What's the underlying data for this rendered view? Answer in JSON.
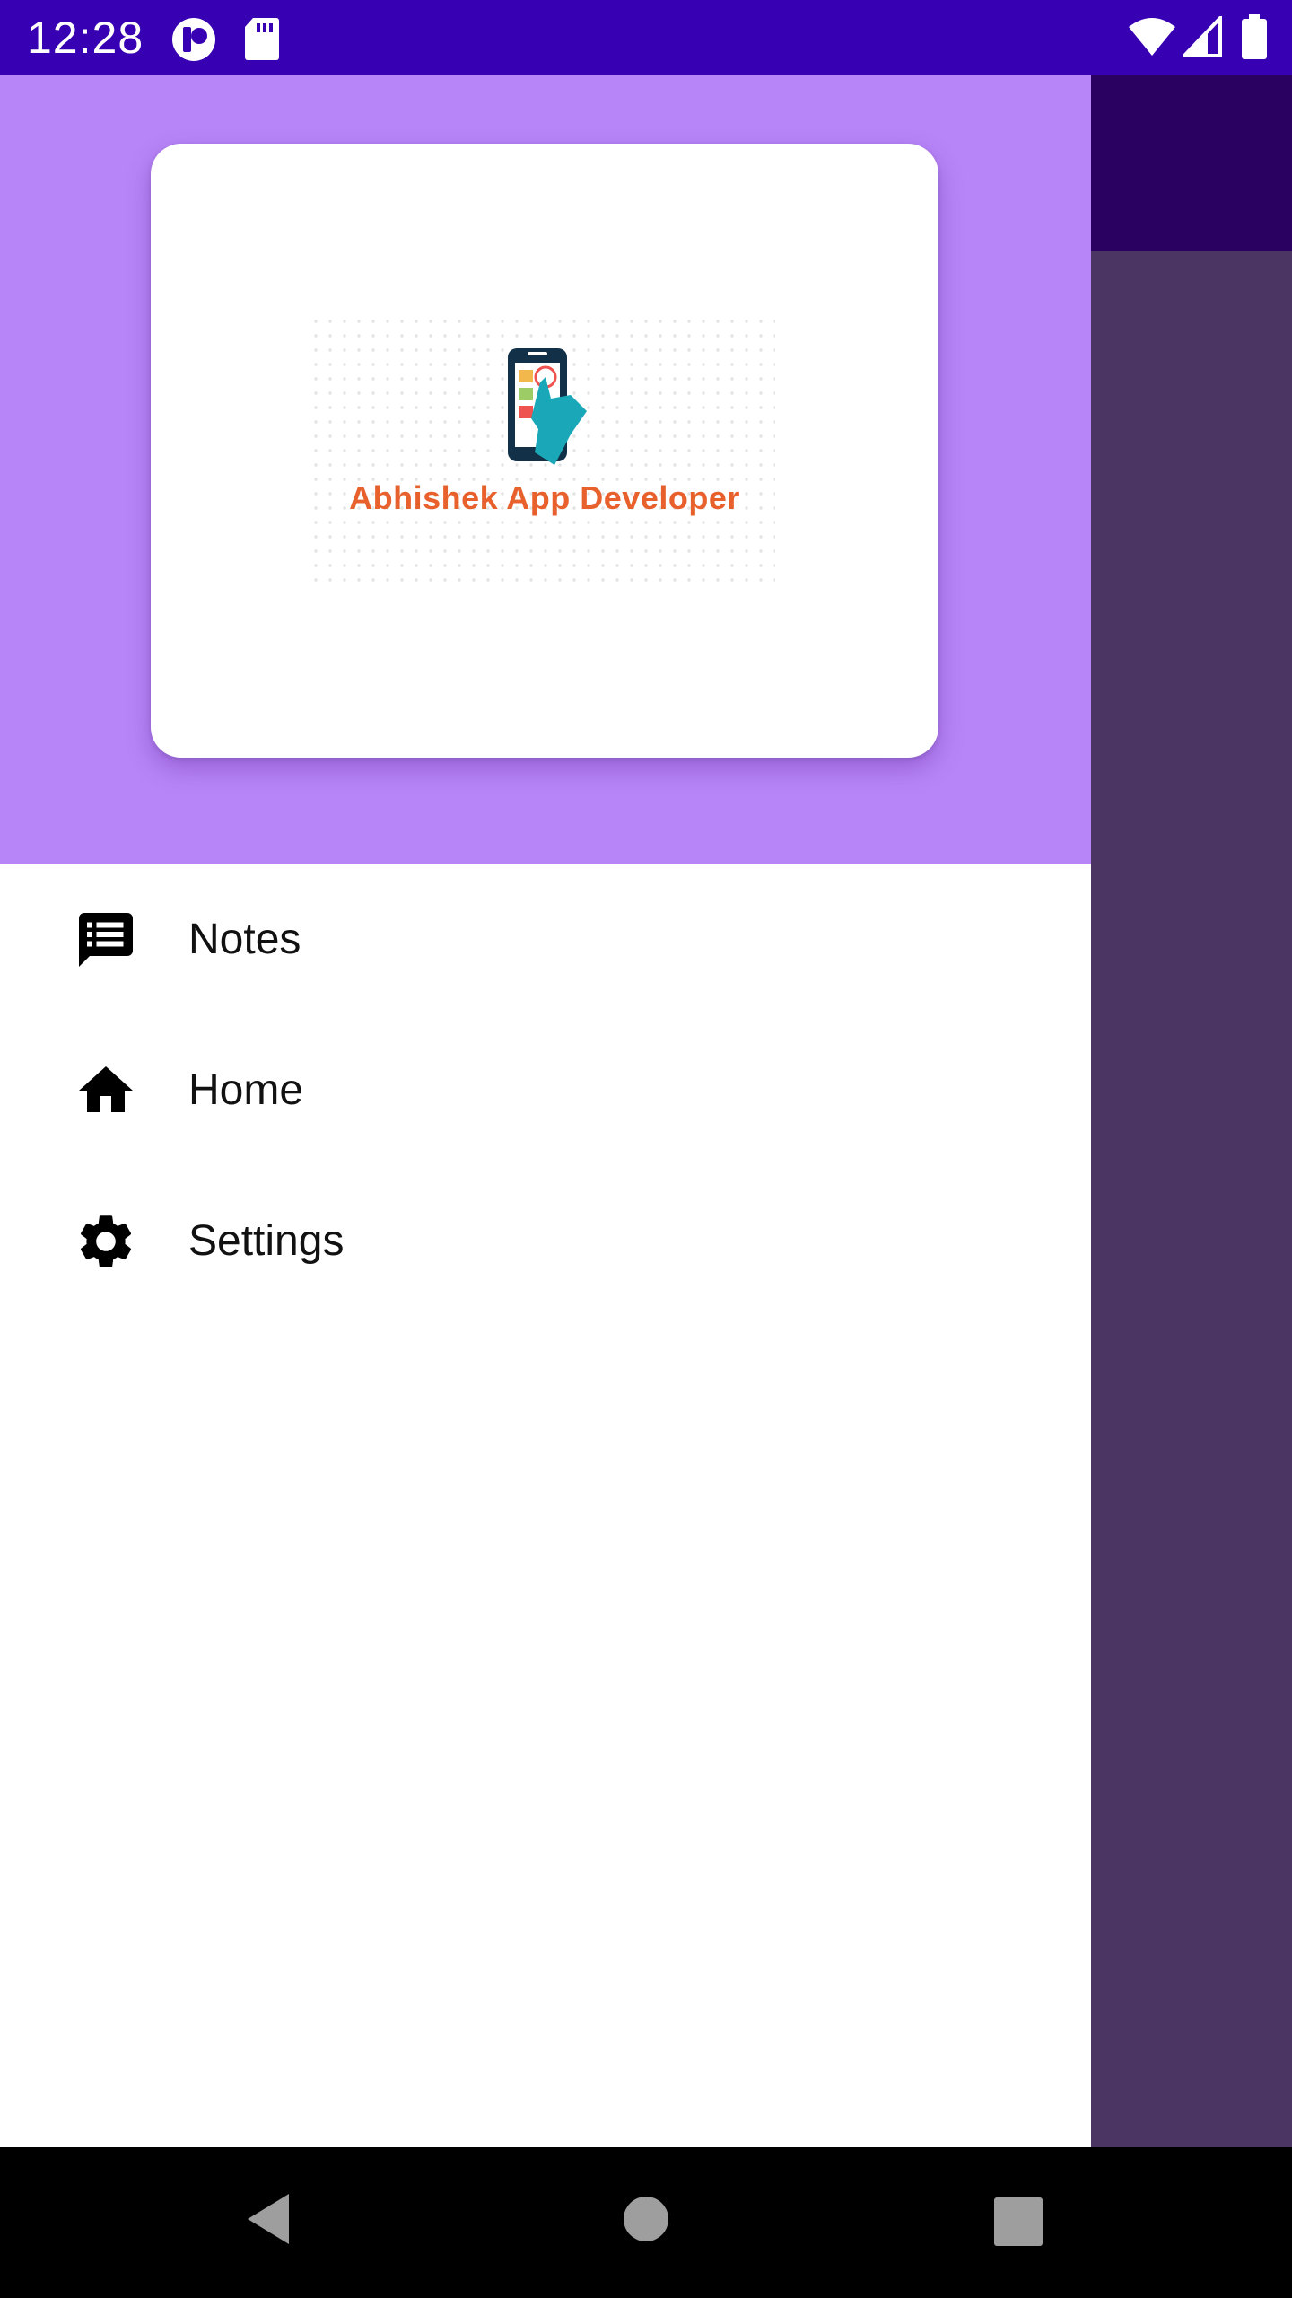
{
  "status_bar": {
    "time": "12:28",
    "icons": [
      "notification-app-icon",
      "sd-card-icon",
      "wifi-icon",
      "cellular-signal-icon",
      "battery-icon"
    ]
  },
  "drawer": {
    "header": {
      "logo_text": "Abhishek App Developer",
      "background_color": "#b885f8"
    },
    "items": [
      {
        "label": "Notes",
        "icon": "notes-icon"
      },
      {
        "label": "Home",
        "icon": "home-icon"
      },
      {
        "label": "Settings",
        "icon": "settings-gear-icon"
      }
    ]
  },
  "nav_bar": {
    "buttons": [
      "back-icon",
      "home-circle-icon",
      "recents-square-icon"
    ]
  },
  "colors": {
    "status_bar": "#3700b3",
    "app_toolbar": "#2a0060",
    "scrim": "#4b3563",
    "logo_text": "#e8602c"
  }
}
